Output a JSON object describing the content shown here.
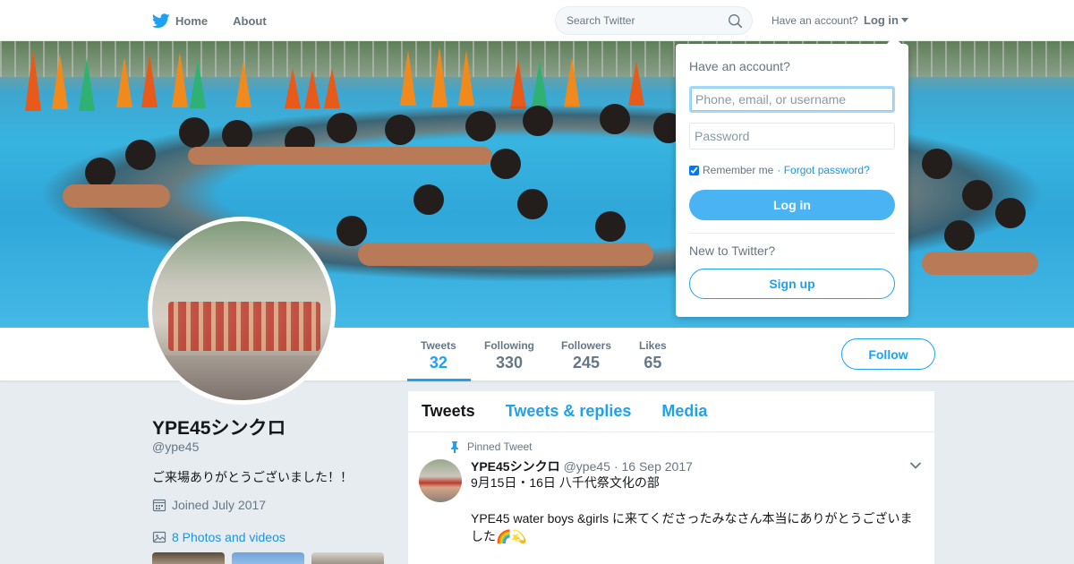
{
  "nav": {
    "home_label": "Home",
    "about_label": "About",
    "search_placeholder": "Search Twitter",
    "have_account": "Have an account?",
    "login_label": "Log in"
  },
  "stats": [
    {
      "label": "Tweets",
      "value": "32"
    },
    {
      "label": "Following",
      "value": "330"
    },
    {
      "label": "Followers",
      "value": "245"
    },
    {
      "label": "Likes",
      "value": "65"
    }
  ],
  "follow_label": "Follow",
  "profile": {
    "name": "YPE45シンクロ",
    "handle": "@ype45",
    "bio": "ご来場ありがとうございました！！",
    "joined": "Joined July 2017",
    "photos": "8 Photos and videos"
  },
  "timeline": {
    "tabs": [
      "Tweets",
      "Tweets & replies",
      "Media"
    ],
    "pinned_label": "Pinned Tweet",
    "tweet": {
      "name": "YPE45シンクロ",
      "handle": "@ype45",
      "date": "· 16 Sep 2017",
      "line1": "9月15日・16日 八千代祭文化の部",
      "line2": "YPE45  water boys &girls に来てくださったみなさん本当にありがとうございま",
      "line3": "した🌈💫"
    }
  },
  "login_dropdown": {
    "title": "Have an account?",
    "username_placeholder": "Phone, email, or username",
    "password_placeholder": "Password",
    "remember": "Remember me",
    "forgot": "· Forgot password?",
    "login_button": "Log in",
    "new_prompt": "New to Twitter?",
    "signup_button": "Sign up"
  },
  "colors": {
    "brand": "#1da1f2",
    "background": "#e6ecf0"
  },
  "icons": [
    "twitter-bird-icon",
    "search-icon",
    "caret-down-icon",
    "calendar-icon",
    "photo-icon",
    "pin-icon",
    "chevron-down-icon"
  ]
}
